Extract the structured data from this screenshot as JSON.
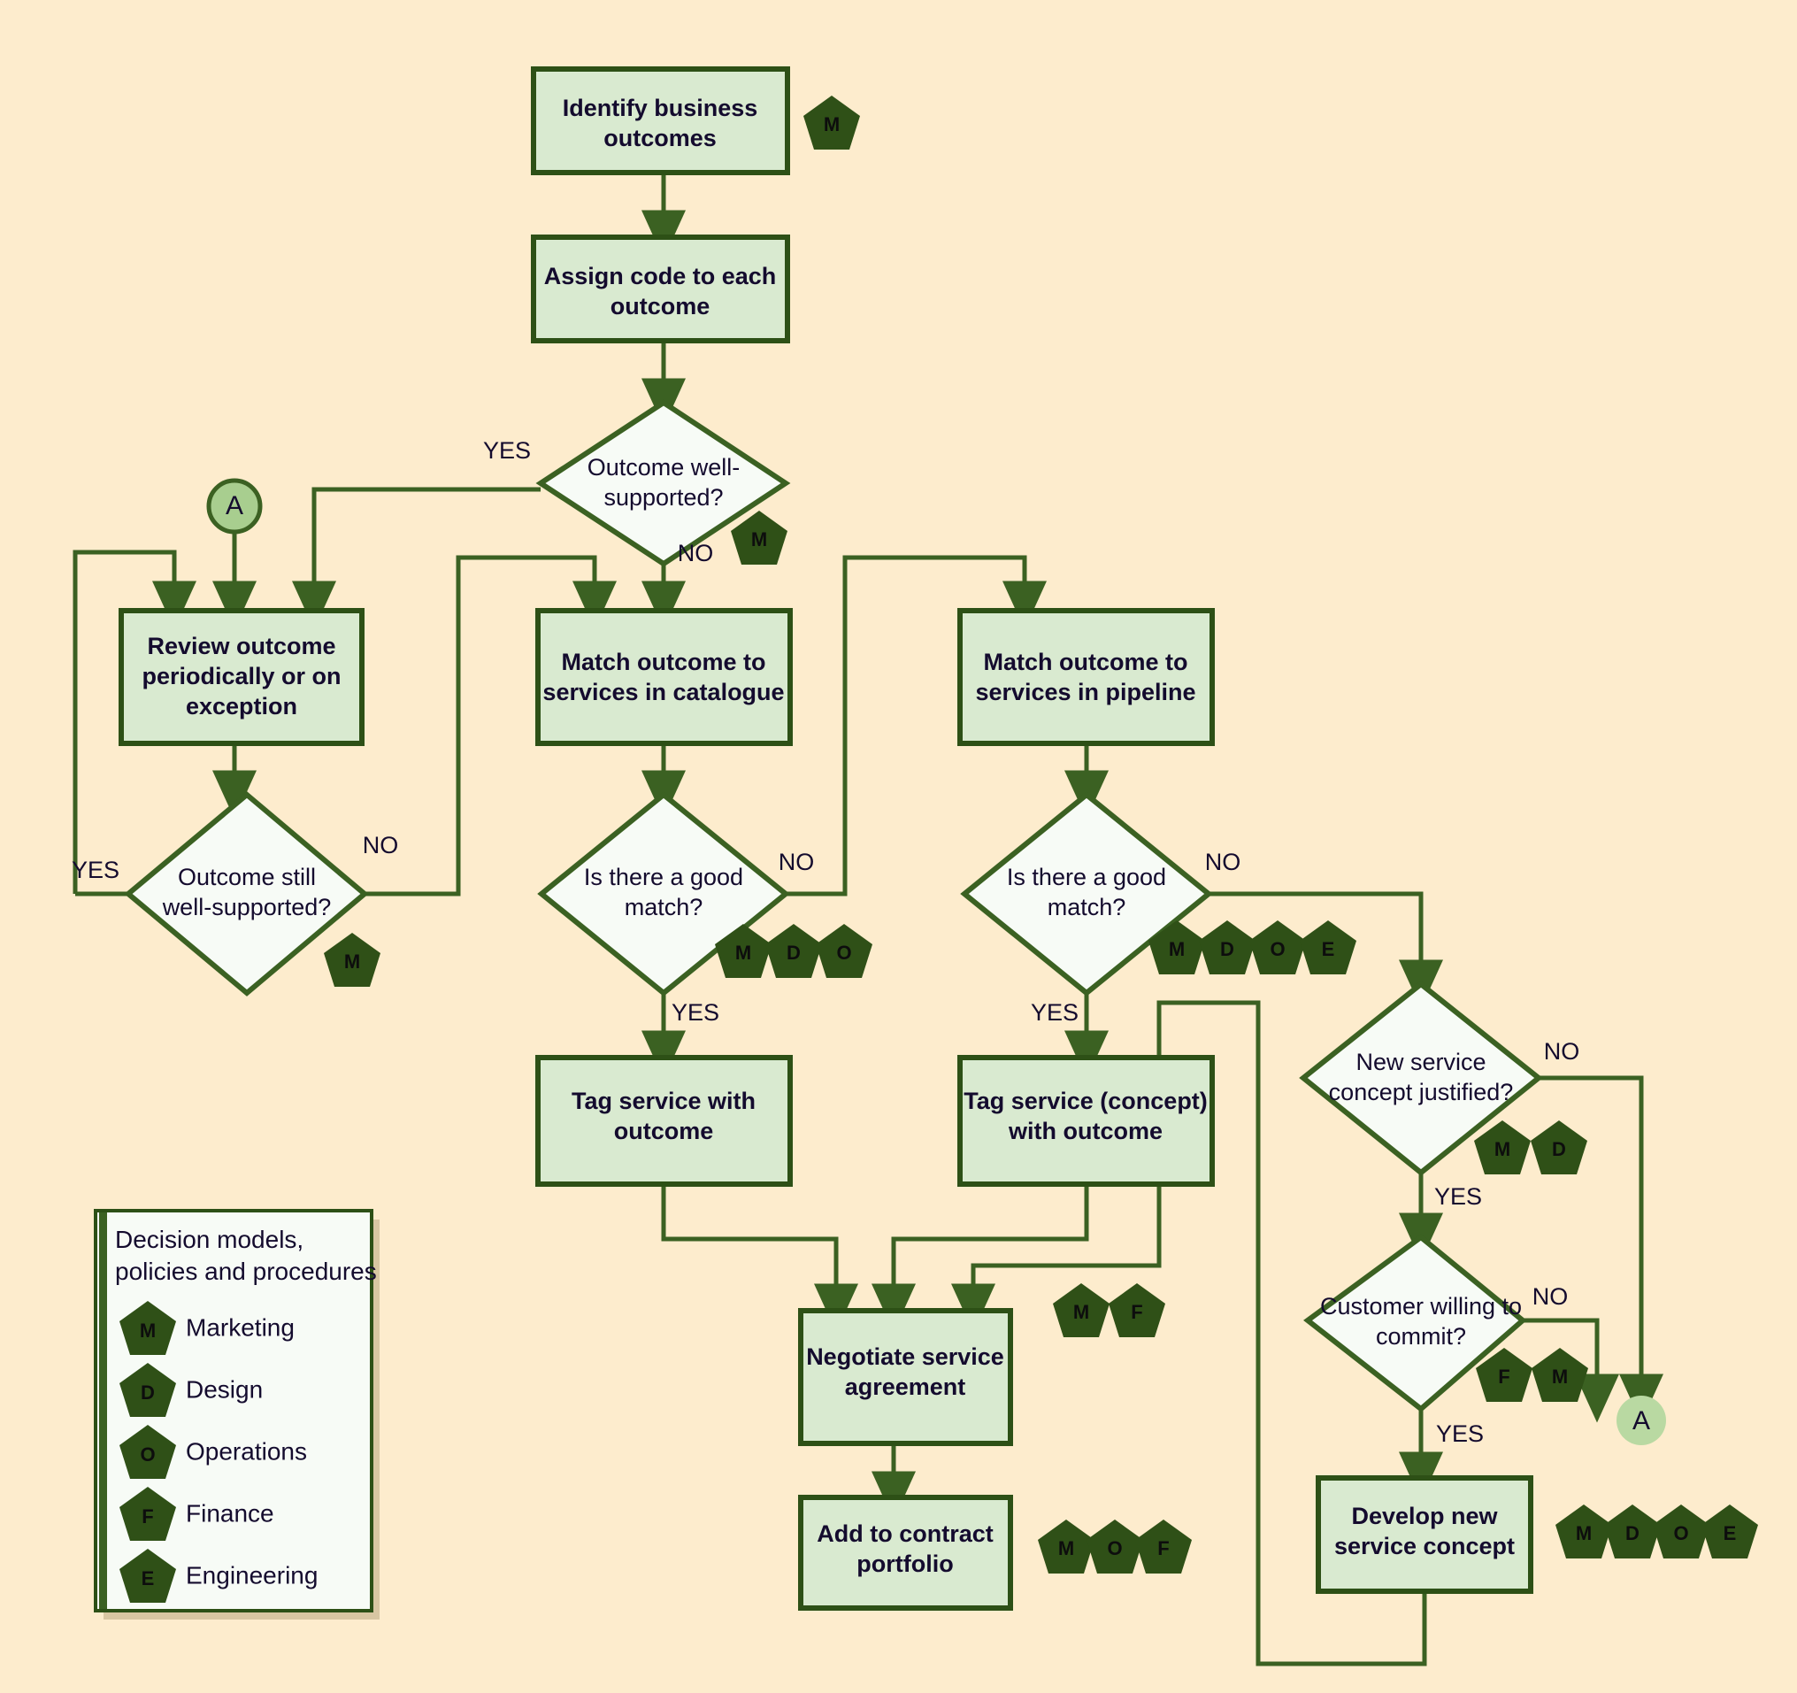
{
  "diagram": {
    "title": "Service portfolio / business outcome matching flowchart",
    "background_color": "#fdeccd",
    "node_fill": "#d9ead0",
    "node_stroke": "#2d5016",
    "decision_fill": "#f7fbf6",
    "line_color": "#3b6122",
    "pentagon_color": "#2f5017",
    "connector_fill": "#a8ce8f",
    "text_color": "#140b2e"
  },
  "nodes": {
    "identify_outcomes": {
      "label": "Identify business\noutcomes",
      "line1": "Identify business",
      "line2": "outcomes",
      "type": "process"
    },
    "assign_code": {
      "label": "Assign code to each\noutcome",
      "line1": "Assign code to each",
      "line2": "outcome",
      "type": "process"
    },
    "outcome_well_supported": {
      "line1": "Outcome well-",
      "line2": "supported?",
      "type": "decision"
    },
    "review_outcome": {
      "line1": "Review outcome",
      "line2": "periodically or on",
      "line3": "exception",
      "type": "process"
    },
    "outcome_still_supported": {
      "line1": "Outcome still",
      "line2": "well-supported?",
      "type": "decision"
    },
    "match_catalogue": {
      "line1": "Match outcome to",
      "line2": "services in catalogue",
      "type": "process"
    },
    "match_pipeline": {
      "line1": "Match outcome to",
      "line2": "services in pipeline",
      "type": "process"
    },
    "good_match_catalogue": {
      "line1": "Is there a good",
      "line2": "match?",
      "type": "decision"
    },
    "good_match_pipeline": {
      "line1": "Is there a good",
      "line2": "match?",
      "type": "decision"
    },
    "tag_service": {
      "line1": "Tag service with",
      "line2": "outcome",
      "type": "process"
    },
    "tag_service_concept": {
      "line1": "Tag service (concept)",
      "line2": "with outcome",
      "type": "process"
    },
    "new_service_justified": {
      "line1": "New service",
      "line2": "concept justified?",
      "type": "decision"
    },
    "customer_willing": {
      "line1": "Customer willing to",
      "line2": "commit?",
      "type": "decision"
    },
    "negotiate_agreement": {
      "line1": "Negotiate service",
      "line2": "agreement",
      "type": "process"
    },
    "add_to_portfolio": {
      "line1": "Add to contract",
      "line2": "portfolio",
      "type": "process"
    },
    "develop_concept": {
      "line1": "Develop new",
      "line2": "service concept",
      "type": "process"
    }
  },
  "connectors": {
    "a_in": {
      "letter": "A"
    },
    "a_out": {
      "letter": "A"
    }
  },
  "edge_labels": {
    "yes": "YES",
    "no": "NO",
    "well_supported_yes": "YES",
    "well_supported_no": "NO",
    "still_supported_yes": "YES",
    "still_supported_no": "NO",
    "catalogue_match_yes": "YES",
    "catalogue_match_no": "NO",
    "pipeline_match_yes": "YES",
    "pipeline_match_no": "NO",
    "justified_yes": "YES",
    "justified_no": "NO",
    "commit_yes": "YES",
    "commit_no": "NO"
  },
  "pentagon_groups": {
    "outcome_well_supported": [
      "M"
    ],
    "outcome_still_supported": [
      "M"
    ],
    "good_match_catalogue": [
      "M",
      "D",
      "O"
    ],
    "good_match_pipeline": [
      "M",
      "D",
      "O",
      "E"
    ],
    "new_service_justified": [
      "M",
      "D"
    ],
    "customer_willing": [
      "F",
      "M"
    ],
    "negotiate_agreement": [
      "M",
      "F"
    ],
    "add_to_portfolio": [
      "M",
      "O",
      "F"
    ],
    "develop_concept": [
      "M",
      "D",
      "O",
      "E"
    ],
    "identify_outcomes": [
      "M"
    ]
  },
  "legend": {
    "title_line1": "Decision models,",
    "title_line2": "policies and procedures",
    "items": [
      {
        "code": "M",
        "label": "Marketing"
      },
      {
        "code": "D",
        "label": "Design"
      },
      {
        "code": "O",
        "label": "Operations"
      },
      {
        "code": "F",
        "label": "Finance"
      },
      {
        "code": "E",
        "label": "Engineering"
      }
    ]
  }
}
